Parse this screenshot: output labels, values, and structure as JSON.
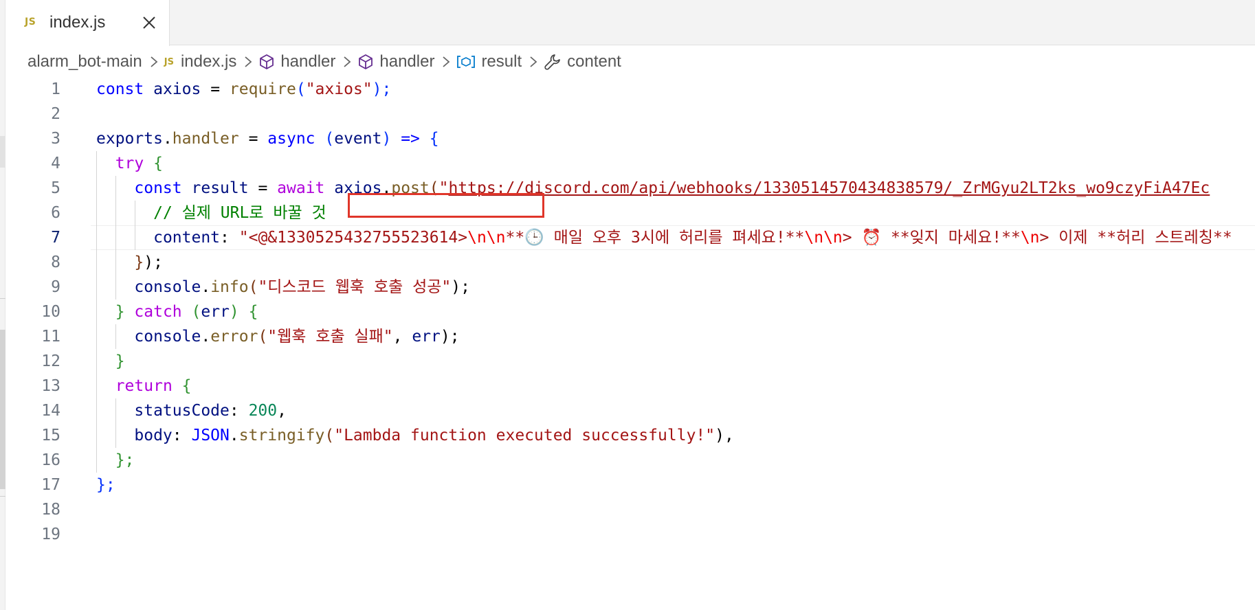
{
  "tab": {
    "icon": "JS",
    "label": "index.js",
    "close_icon": "close-icon"
  },
  "breadcrumb": {
    "items": [
      {
        "label": "alarm_bot-main",
        "icon": ""
      },
      {
        "label": "index.js",
        "icon": "JS"
      },
      {
        "label": "handler",
        "icon": "cube-icon"
      },
      {
        "label": "handler",
        "icon": "cube-icon"
      },
      {
        "label": "result",
        "icon": "variable-icon"
      },
      {
        "label": "content",
        "icon": "wrench-icon"
      }
    ]
  },
  "editor": {
    "active_line": 7,
    "line_numbers": [
      "1",
      "2",
      "3",
      "4",
      "5",
      "6",
      "7",
      "8",
      "9",
      "10",
      "11",
      "12",
      "13",
      "14",
      "15",
      "16",
      "17",
      "18",
      "19"
    ],
    "tokens": {
      "l1": [
        "const",
        "axios",
        " = ",
        "require",
        "(",
        "\"axios\"",
        ");"
      ],
      "l3": [
        "exports",
        ".",
        "handler",
        " = ",
        "async",
        " (",
        "event",
        ") ",
        "=>",
        " {"
      ],
      "l4": [
        "try",
        " {"
      ],
      "l5": [
        "const",
        "result",
        " = ",
        "await",
        "axios",
        ".",
        "post",
        "(",
        "\"",
        "https://discord.com/api/webhooks/1330514570434838579/_ZrMGyu2LT2ks_wo9czyFiA47Ec"
      ],
      "l6": [
        "// 실제 URL로 바꿀 것"
      ],
      "l7": [
        "content",
        ": ",
        "\"",
        "<@&1330525432755523614>",
        "\\n\\n",
        "**🕒 매일 오후 3시에 허리를 펴세요!**",
        "\\n\\n",
        "> ⏰ **잊지 마세요!**",
        "\\n",
        "> 이제 **허리 스트레칭**"
      ],
      "l8": [
        "}",
        ");"
      ],
      "l9": [
        "console",
        ".",
        "info",
        "(",
        "\"디스코드 웹훅 호출 성공\"",
        ");"
      ],
      "l10": [
        "}",
        "catch",
        " (",
        "err",
        ") ",
        "{"
      ],
      "l11": [
        "console",
        ".",
        "error",
        "(",
        "\"웹훅 호출 실패\"",
        ", ",
        "err",
        ");"
      ],
      "l12": [
        "}"
      ],
      "l13": [
        "return",
        " {"
      ],
      "l14": [
        "statusCode",
        ": ",
        "200",
        ","
      ],
      "l15": [
        "body",
        ": ",
        "JSON",
        ".",
        "stringify",
        "(",
        "\"Lambda function executed successfully!\"",
        "),"
      ],
      "l16": [
        "};"
      ],
      "l17": [
        "};"
      ]
    }
  },
  "colors": {
    "highlight_box": "#e0362a",
    "js_icon": "#b8a22a",
    "symbol_icon": "#652d90",
    "variable_icon": "#007acc"
  }
}
